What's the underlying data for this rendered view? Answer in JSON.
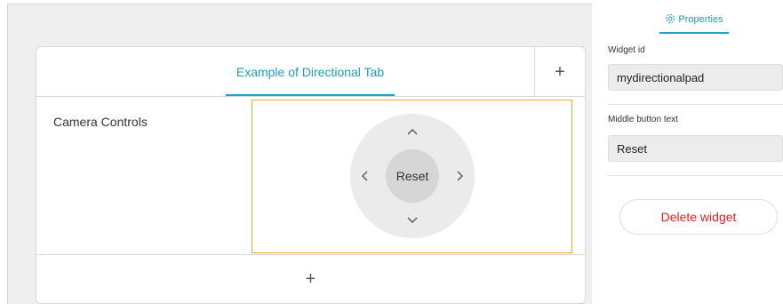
{
  "editor": {
    "tab_label": "Example of Directional Tab",
    "tab_add_icon": "+",
    "row_label": "Camera Controls",
    "add_row_icon": "+",
    "dpad": {
      "center_label": "Reset",
      "up_icon": "^",
      "down_icon": "⌄",
      "left_icon": "<",
      "right_icon": ">"
    },
    "accent_color": "#1ba0c8",
    "selection_color": "#f0a81e"
  },
  "properties": {
    "tab_label": "Properties",
    "tab_icon": "gear-icon",
    "widget_id_label": "Widget id",
    "widget_id_value": "mydirectionalpad",
    "middle_text_label": "Middle button text",
    "middle_text_value": "Reset",
    "delete_label": "Delete widget",
    "delete_color": "#e02020"
  }
}
